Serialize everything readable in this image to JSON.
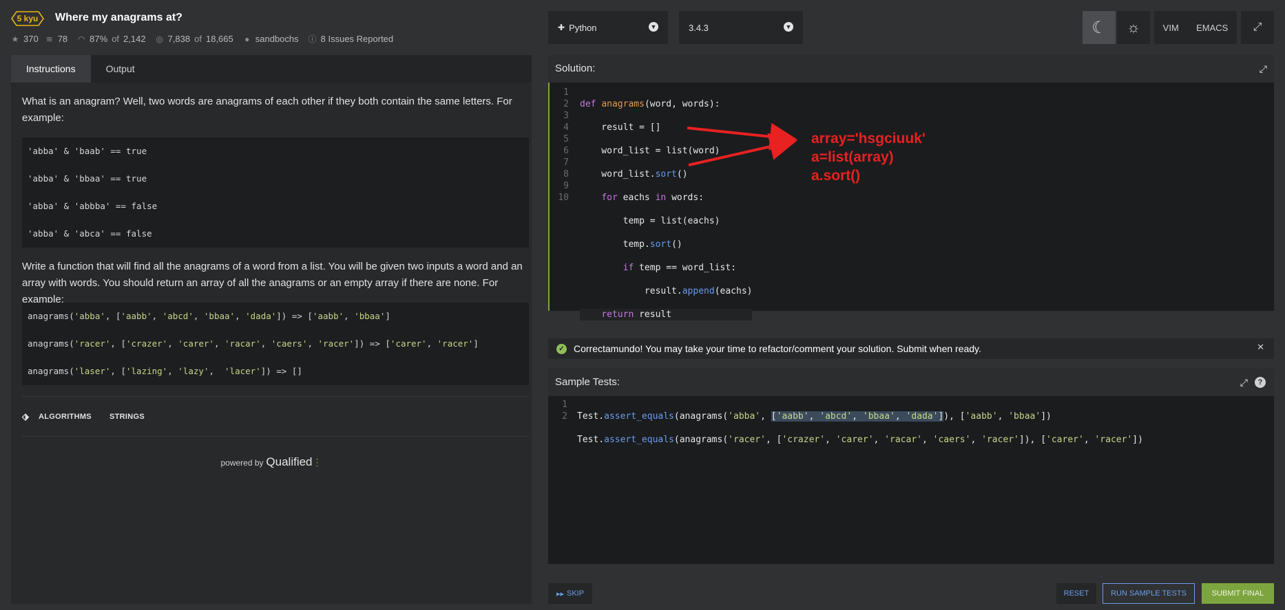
{
  "header": {
    "kyu": "5 kyu",
    "title": "Where my anagrams at?",
    "stats": {
      "stars": "370",
      "collections": "78",
      "satisfaction": "87%",
      "satisfaction_of": "of",
      "satisfaction_total": "2,142",
      "completed": "7,838",
      "completed_of": "of",
      "completed_total": "18,665",
      "author": "sandbochs",
      "issues": "8 Issues Reported"
    },
    "language": "Python",
    "version": "3.4.3",
    "vim": "VIM",
    "emacs": "EMACS"
  },
  "instructions": {
    "tab_instructions": "Instructions",
    "tab_output": "Output",
    "intro": "What is an anagram? Well, two words are anagrams of each other if they both contain the same letters. For example:",
    "examples1": [
      "'abba' & 'baab' == true",
      "'abba' & 'bbaa' == true",
      "'abba' & 'abbba' == false",
      "'abba' & 'abca' == false"
    ],
    "task": "Write a function that will find all the anagrams of a word from a list. You will be given two inputs a word and an array with words. You should return an array of all the anagrams or an empty array if there are none. For example:",
    "ex2_line1": {
      "a": "anagrams(",
      "s1": "'abba'",
      "b": ", [",
      "s2": "'aabb'",
      "c": ", ",
      "s3": "'abcd'",
      "d": ", ",
      "s4": "'bbaa'",
      "e": ", ",
      "s5": "'dada'",
      "f": "]) => [",
      "s6": "'aabb'",
      "g": ", ",
      "s7": "'bbaa'",
      "h": "]"
    },
    "ex2_line2": {
      "a": "anagrams(",
      "s1": "'racer'",
      "b": ", [",
      "s2": "'crazer'",
      "c": ", ",
      "s3": "'carer'",
      "d": ", ",
      "s4": "'racar'",
      "e": ", ",
      "s5": "'caers'",
      "f": ", ",
      "s6": "'racer'",
      "g": "]) => [",
      "s7": "'carer'",
      "h": ", ",
      "s8": "'racer'",
      "i": "]"
    },
    "ex2_line3": {
      "a": "anagrams(",
      "s1": "'laser'",
      "b": ", [",
      "s2": "'lazing'",
      "c": ", ",
      "s3": "'lazy'",
      "d": ",  ",
      "s4": "'lacer'",
      "e": "]) => []"
    },
    "tags": [
      "ALGORITHMS",
      "STRINGS"
    ],
    "powered_by": "powered by",
    "qualified": "Qualified"
  },
  "solution": {
    "title": "Solution:",
    "line_numbers": [
      "1",
      "2",
      "3",
      "4",
      "5",
      "6",
      "7",
      "8",
      "9",
      "10"
    ]
  },
  "annotation": {
    "line1": "array='hsgciuuk'",
    "line2": "a=list(array)",
    "line3": "a.sort()",
    "color": "#e82121"
  },
  "success": {
    "message": "Correctamundo! You may take your time to refactor/comment your solution. Submit when ready."
  },
  "tests": {
    "title": "Sample Tests:",
    "line_numbers": [
      "1",
      "2"
    ]
  },
  "buttons": {
    "skip": "SKIP",
    "reset": "RESET",
    "run": "RUN SAMPLE TESTS",
    "submit": "SUBMIT FINAL"
  },
  "colors": {
    "accent_green": "#7da53f",
    "accent_blue": "#6b9ce8",
    "kyu_yellow": "#ecb613"
  }
}
